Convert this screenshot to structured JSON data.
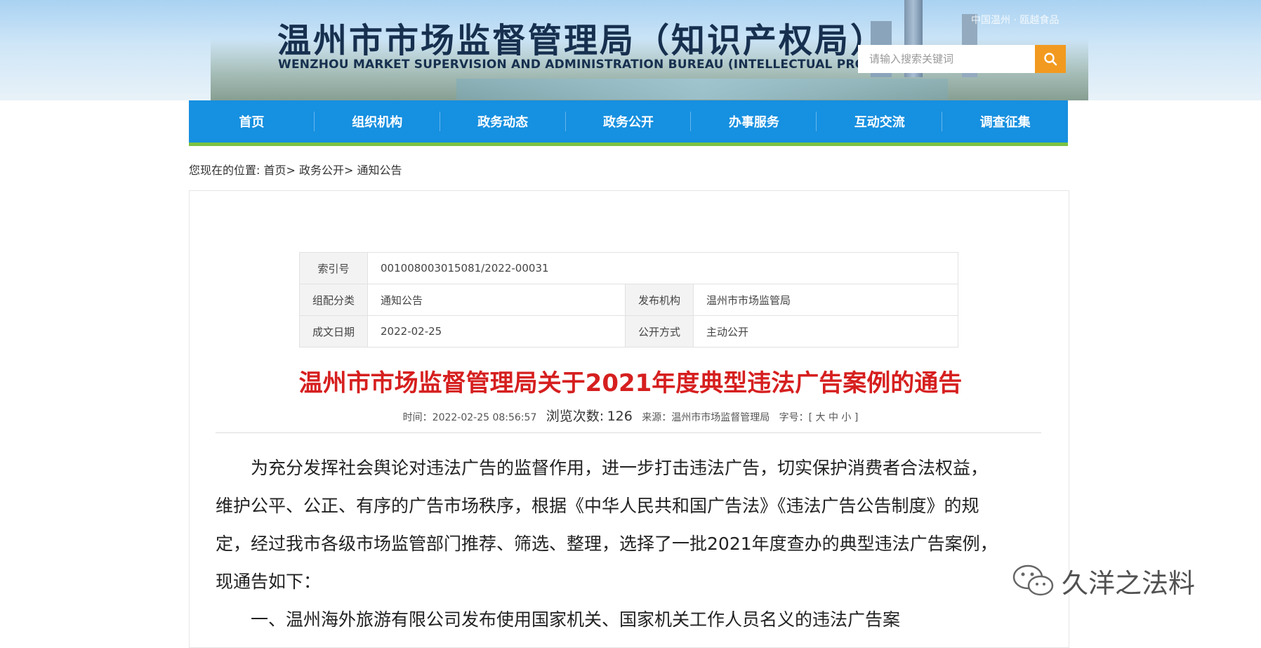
{
  "header": {
    "title": "温州市市场监督管理局（知识产权局）",
    "subtitle": "WENZHOU MARKET SUPERVISION AND ADMINISTRATION BUREAU (INTELLECTUAL PROPERTY OFFICE)",
    "top_link": "中国温州 · 瓯越食品",
    "search_placeholder": "请输入搜索关键词",
    "search_icon": "search-icon"
  },
  "nav": [
    "首页",
    "组织机构",
    "政务动态",
    "政务公开",
    "办事服务",
    "互动交流",
    "调查征集"
  ],
  "breadcrumb": {
    "prefix": "您现在的位置:",
    "items": [
      "首页>",
      "政务公开>",
      "通知公告"
    ]
  },
  "meta": {
    "index_label": "索引号",
    "index_value": "001008003015081/2022-00031",
    "category_label": "组配分类",
    "category_value": "通知公告",
    "publisher_label": "发布机构",
    "publisher_value": "温州市市场监管局",
    "date_label": "成文日期",
    "date_value": "2022-02-25",
    "disclosure_label": "公开方式",
    "disclosure_value": "主动公开"
  },
  "article": {
    "title": "温州市市场监督管理局关于2021年度典型违法广告案例的通告",
    "time": "时间：2022-02-25 08:56:57",
    "views_label": "浏览次数:",
    "views": "126",
    "source": "来源：温州市市场监督管理局",
    "font_label": "字号：[",
    "font_large": "大",
    "font_medium": "中",
    "font_small": "小",
    "font_end": "]",
    "paragraph1_line1": "为充分发挥社会舆论对违法广告的监督作用，进一步打击违法广告，切实保护消费者合法权益，",
    "paragraph1_line2": "维护公平、公正、有序的广告市场秩序，根据《中华人民共和国广告法》《违法广告公告制度》的规",
    "paragraph1_line3": "定，经过我市各级市场监管部门推荐、筛选、整理，选择了一批2021年度查办的典型违法广告案例，",
    "paragraph1_line4": "现通告如下：",
    "item1": "一、温州海外旅游有限公司发布使用国家机关、国家机关工作人员名义的违法广告案"
  },
  "watermark": {
    "text": "久洋之法料",
    "icon": "wechat-icon"
  }
}
